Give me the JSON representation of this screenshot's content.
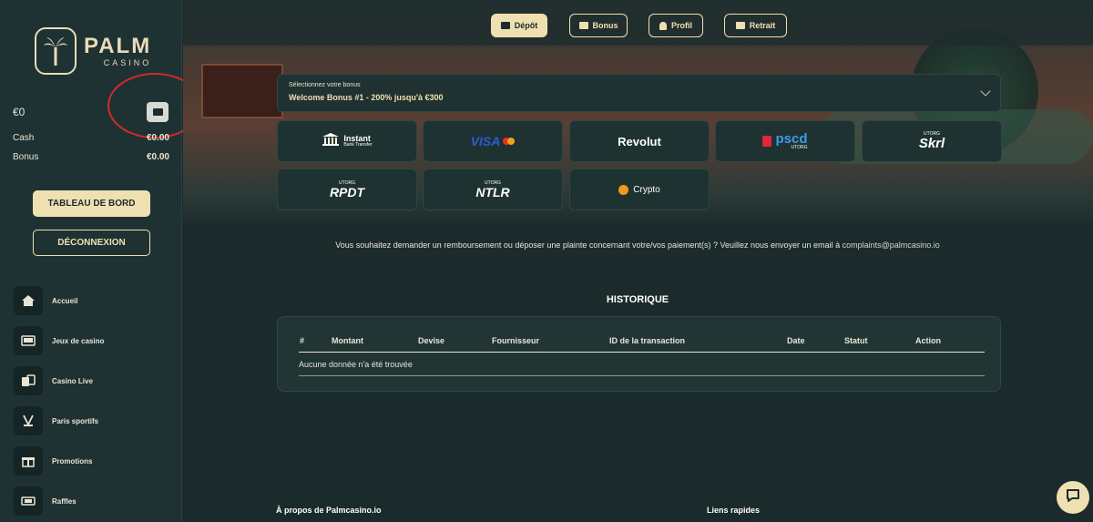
{
  "brand": {
    "name": "PALM",
    "sub": "CASINO"
  },
  "balance": {
    "amount": "€0",
    "cash_label": "Cash",
    "cash_value": "€0.00",
    "bonus_label": "Bonus",
    "bonus_value": "€0.00"
  },
  "sidebar": {
    "dashboard": "TABLEAU DE BORD",
    "logout": "DÉCONNEXION",
    "items": [
      {
        "label": "Accueil",
        "icon": "home-icon"
      },
      {
        "label": "Jeux de casino",
        "icon": "slot-machine-icon"
      },
      {
        "label": "Casino Live",
        "icon": "cards-icon"
      },
      {
        "label": "Paris sportifs",
        "icon": "hockey-icon"
      },
      {
        "label": "Promotions",
        "icon": "gift-icon"
      },
      {
        "label": "Raffles",
        "icon": "ticket-icon"
      }
    ]
  },
  "topnav": [
    {
      "label": "Dépôt",
      "active": true
    },
    {
      "label": "Bonus",
      "active": false
    },
    {
      "label": "Profil",
      "active": false
    },
    {
      "label": "Retrait",
      "active": false
    }
  ],
  "bonus_select": {
    "label": "Sélectionnez votre bonus",
    "value": "Welcome Bonus #1 - 200% jusqu'à €300"
  },
  "payments": {
    "instant_main": "Instant",
    "instant_sub": "Bank Transfer",
    "visa": "VISA",
    "revolut": "Revolut",
    "pscd": "pscd",
    "pscd_sub": "UTORG",
    "skrl": "Skrl",
    "skrl_tag": "UTORG",
    "rpdt": "RPDT",
    "rpdt_tag": "UTORG",
    "ntlr": "NTLR",
    "ntlr_tag": "UTORG",
    "crypto": "Crypto"
  },
  "notice": {
    "text": "Vous souhaitez demander un remboursement ou déposer une plainte concernant votre/vos paiement(s) ? Veuillez nous envoyer un email à ",
    "email": "complaints@palmcasino.io"
  },
  "history": {
    "title": "HISTORIQUE",
    "columns": [
      "#",
      "Montant",
      "Devise",
      "Fournisseur",
      "ID de la transaction",
      "Date",
      "Statut",
      "Action"
    ],
    "empty": "Aucune donnée n'a été trouvée"
  },
  "footer": {
    "about": "À propos de Palmcasino.io",
    "links": "Liens rapides"
  },
  "colors": {
    "accent": "#efe0b2",
    "bg": "#1b2b2c",
    "highlight_circle": "#d42a2a"
  }
}
